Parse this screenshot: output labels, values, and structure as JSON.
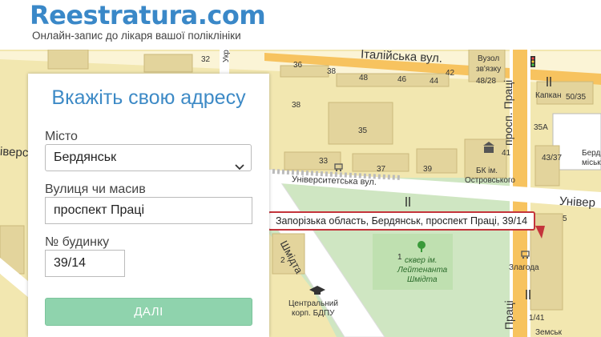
{
  "header": {
    "logo": "Reestratura.com",
    "tagline": "Онлайн-запис до лікаря вашої поліклініки"
  },
  "form": {
    "title": "Вкажіть свою адресу",
    "city_label": "Місто",
    "city_value": "Бердянськ",
    "street_label": "Вулиця чи масив",
    "street_value": "проспект Праці",
    "house_label": "№ будинку",
    "house_value": "39/14",
    "submit_label": "ДАЛІ"
  },
  "map": {
    "callout": "Запорізька область, Бердянськ, проспект Праці, 39/14",
    "street_labels": {
      "italiiska": "Італійська вул.",
      "universytetska": "Університетська вул.",
      "universytetska_right": "Універ",
      "universytetska_left": "іверси",
      "shmidta_left": "Шмідта",
      "prosp_pratsi": "просп. Праці",
      "pratsi_bottom": "Праці",
      "zemska": "Земськ",
      "ukr": "Укра"
    },
    "places": {
      "vuzol1": "Вузол",
      "vuzol2": "зв'язку",
      "kapkan": "Капкан",
      "bk1": "БК ім.",
      "bk2": "Островського",
      "skver1": "сквер ім.",
      "skver2": "Лейтенанта",
      "skver3": "Шмідта",
      "zlahoda": "Злагода",
      "tsentr1": "Центральний",
      "tsentr2": "корп. БДПУ",
      "berd1": "Берд",
      "berd2": "міськ"
    },
    "house_numbers": {
      "n32": "32",
      "n36": "36",
      "n38a": "38",
      "n38b": "38",
      "n35": "35",
      "n33": "33",
      "n37": "37",
      "n39": "39",
      "n48": "48",
      "n46": "46",
      "n44": "44",
      "n42": "42",
      "n48_28": "48/28",
      "n50_35": "50/35",
      "n35a": "35А",
      "n41": "41",
      "n43_37": "43/37",
      "n1": "1",
      "n1_41": "1/41",
      "n2": "2",
      "n5": "5"
    }
  },
  "colors": {
    "brand": "#3a88c8",
    "button": "#8fd3ad",
    "callout_border": "#c4343b",
    "map_bg": "#f2e7b0",
    "park": "#cfe6c2",
    "major_road": "#f7c35f"
  },
  "icons": [
    "chevron-down-icon",
    "traffic-light-icon",
    "restaurant-icon",
    "museum-icon",
    "cart-icon",
    "tree-icon",
    "university-icon"
  ]
}
